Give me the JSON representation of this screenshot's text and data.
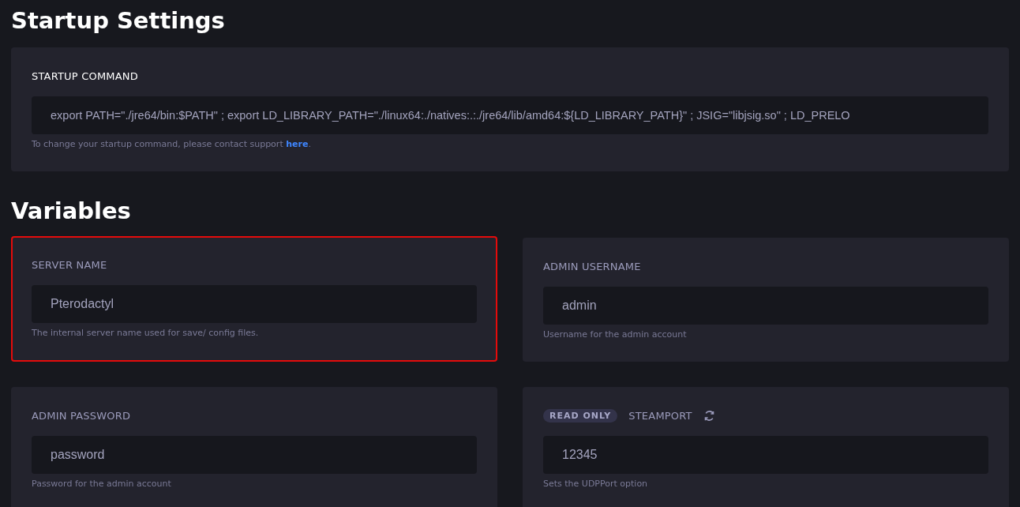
{
  "startup": {
    "title": "Startup Settings",
    "label": "STARTUP COMMAND",
    "command": "export PATH=\"./jre64/bin:$PATH\" ; export LD_LIBRARY_PATH=\"./linux64:./natives:.:./jre64/lib/amd64:${LD_LIBRARY_PATH}\" ; JSIG=\"libjsig.so\" ; LD_PRELO",
    "help": "To change your startup command, please contact support ",
    "link": "here",
    "help_end": "."
  },
  "variables_title": "Variables",
  "variables": [
    {
      "name": "SERVER NAME",
      "value": "Pterodactyl",
      "description": "The internal server name used for save/ config files.",
      "highlighted": true,
      "read_only": false
    },
    {
      "name": "ADMIN USERNAME",
      "value": "admin",
      "description": "Username for the admin account",
      "highlighted": false,
      "read_only": false
    },
    {
      "name": "ADMIN PASSWORD",
      "value": "password",
      "description": "Password for the admin account",
      "highlighted": false,
      "read_only": false
    },
    {
      "name": "STEAMPORT",
      "value": "12345",
      "description": "Sets the UDPPort option",
      "highlighted": false,
      "read_only": true,
      "badge": "READ ONLY"
    }
  ]
}
